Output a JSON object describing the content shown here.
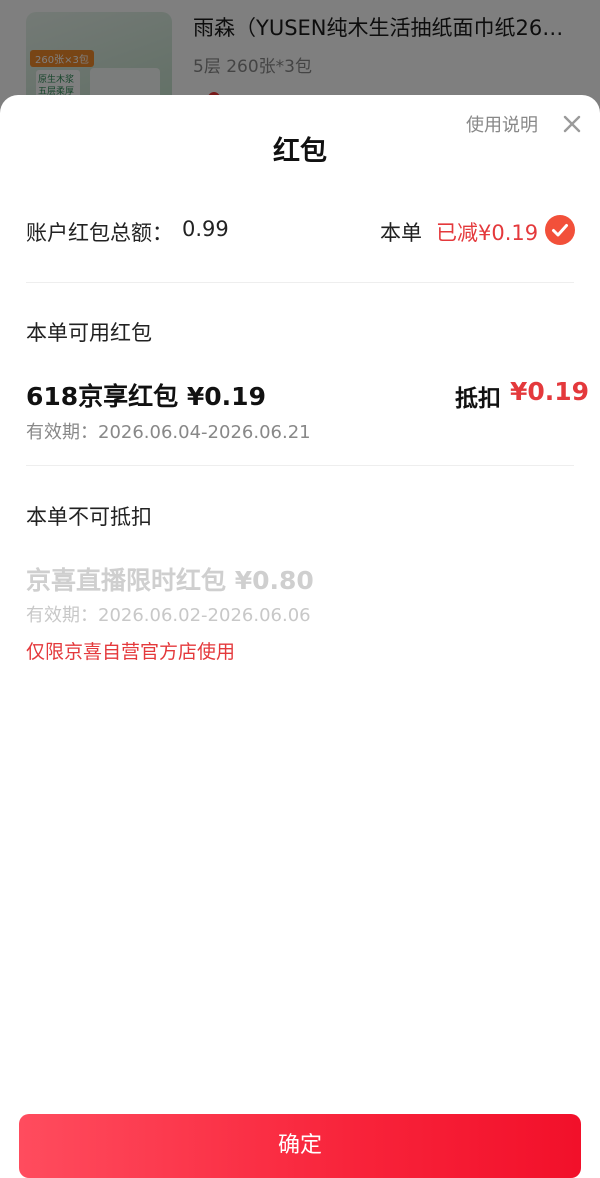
{
  "background_product": {
    "title": "雨森（YUSEN纯木生活抽纸面巾纸26…",
    "spec": "5层 260张*3包",
    "thumb_tag": "260张×3包",
    "thumb_box_text": "原生木浆\n五层柔厚"
  },
  "sheet": {
    "title": "红包",
    "help_link": "使用说明"
  },
  "account": {
    "label": "账户红包总额：",
    "total": "0.99",
    "order_label": "本单",
    "reduced": "已减¥0.19",
    "selected": true
  },
  "available": {
    "section_title": "本单可用红包",
    "coupons": [
      {
        "name": "618京享红包 ¥0.19",
        "validity": "有效期：2026.06.04-2026.06.21",
        "deduct_label": "抵扣",
        "deduct_amount": "¥0.19"
      }
    ]
  },
  "unavailable": {
    "section_title": "本单不可抵扣",
    "coupons": [
      {
        "name": "京喜直播限时红包 ¥0.80",
        "validity": "有效期：2026.06.02-2026.06.06",
        "restriction": "仅限京喜自营官方店使用"
      }
    ]
  },
  "footer": {
    "confirm_label": "确定"
  },
  "colors": {
    "accent_red": "#e4393c",
    "check_orange": "#f2503a",
    "button_gradient_start": "#ff4c5e",
    "button_gradient_end": "#f2102a"
  },
  "icons": {
    "close": "close-icon",
    "check": "check-circle-icon"
  }
}
